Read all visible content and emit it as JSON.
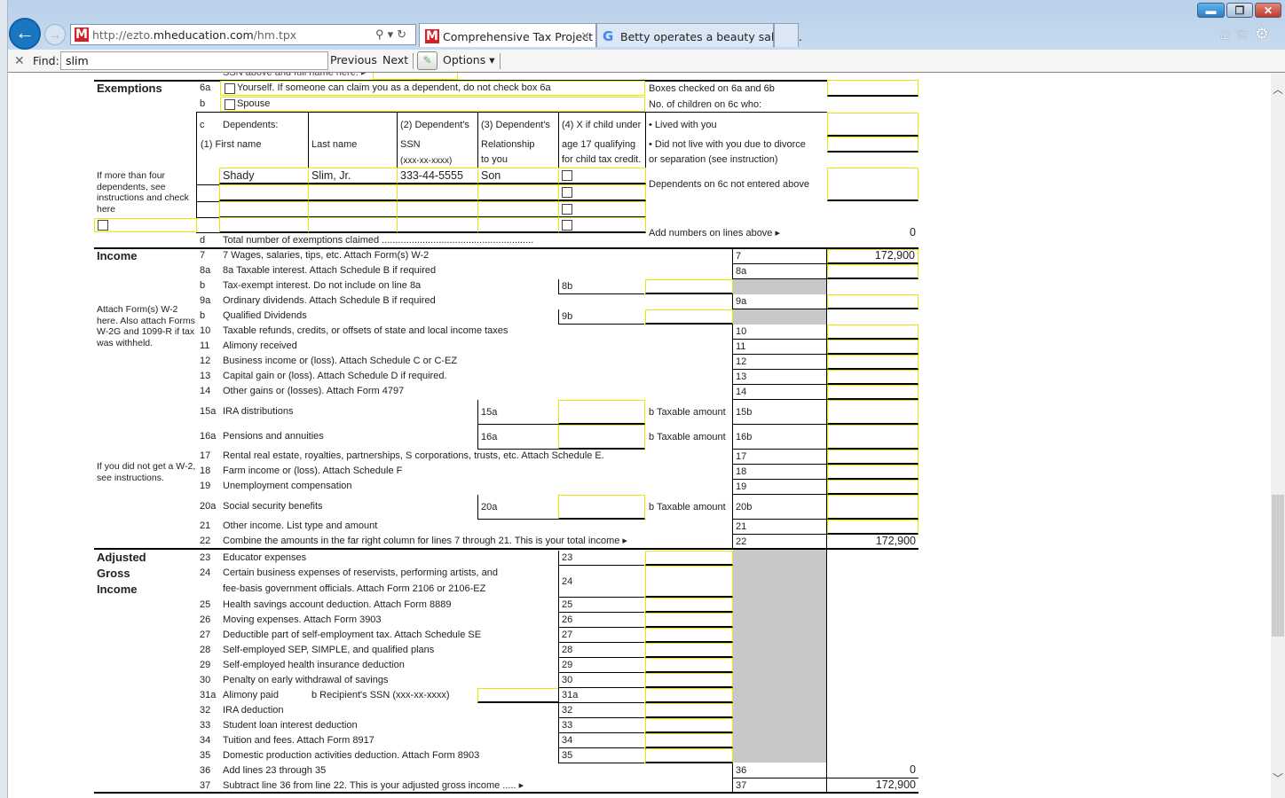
{
  "browser": {
    "url_prefix": "http://ezto.",
    "url_domain": "mheducation.com",
    "url_path": "/hm.tpx",
    "tabs": [
      {
        "label": "Comprehensive Tax Project",
        "icon": "mheducation-icon",
        "active": true
      },
      {
        "label": "Betty operates a beauty salon ...",
        "icon": "google-icon",
        "active": false
      }
    ],
    "find": {
      "label": "Find:",
      "value": "slim",
      "previous": "Previous",
      "next": "Next",
      "options": "Options"
    }
  },
  "form": {
    "top_cutoff": "SSN above and full name here. ▸",
    "exemptions": {
      "heading": "Exemptions",
      "line_6a": {
        "num": "6a",
        "label": "Yourself. If someone can claim you as a dependent, do not check box 6a",
        "checked": false
      },
      "line_6b": {
        "num": "b",
        "label": "Spouse",
        "checked": false
      },
      "dependents_header": {
        "c": "c",
        "dependents": "Dependents:",
        "first_name": "(1) First name",
        "last_name": "Last name",
        "ssn_1": "(2) Dependent's",
        "ssn_2": "SSN",
        "ssn_3": "(xxx-xx-xxxx)",
        "rel_1": "(3) Dependent's",
        "rel_2": "Relationship",
        "rel_3": "to you",
        "child_1": "(4) X if child under",
        "child_2": "age 17 qualifying",
        "child_3": "for child tax credit."
      },
      "dependents": [
        {
          "first": "Shady",
          "last": "Slim, Jr.",
          "ssn": "333-44-5555",
          "relationship": "Son",
          "child_credit": false
        },
        {
          "first": "",
          "last": "",
          "ssn": "",
          "relationship": "",
          "child_credit": false
        },
        {
          "first": "",
          "last": "",
          "ssn": "",
          "relationship": "",
          "child_credit": false
        },
        {
          "first": "",
          "last": "",
          "ssn": "",
          "relationship": "",
          "child_credit": false
        }
      ],
      "more_than_four": "If more than four dependents, see instructions and check here",
      "line_d": {
        "num": "d",
        "label": "Total number of exemptions claimed ........................................................"
      },
      "right": {
        "boxes_checked": "Boxes checked on 6a and 6b",
        "no_children": "No. of children on 6c who:",
        "lived_with": "• Lived with you",
        "did_not_live_1": "• Did not live with you due to divorce",
        "did_not_live_2": "or separation (see instruction)",
        "dependents_not_entered": "Dependents on 6c not entered above",
        "add_numbers": "Add numbers on lines above ▸",
        "total": "0"
      }
    },
    "income": {
      "heading": "Income",
      "attach_note": "Attach Form(s) W-2 here. Also attach Forms W-2G and 1099-R if tax was withheld.",
      "no_w2_note": "If you did not get a W-2, see instructions.",
      "taxable_amount": "b Taxable amount",
      "lines": [
        {
          "num": "7",
          "label": "7 Wages, salaries, tips, etc. Attach Form(s) W-2",
          "box": "7",
          "value": "172,900"
        },
        {
          "num": "8a",
          "label": "8a Taxable interest. Attach Schedule B if required",
          "box": "8a",
          "value": ""
        },
        {
          "num": "b",
          "label": "Tax-exempt interest. Do not include on line 8a",
          "box": "8b",
          "value": ""
        },
        {
          "num": "9a",
          "label": "Ordinary dividends. Attach Schedule B if required",
          "box": "9a",
          "value": ""
        },
        {
          "num": "b",
          "label": "Qualified Dividends",
          "box": "9b",
          "value": ""
        },
        {
          "num": "10",
          "label": "Taxable refunds, credits, or offsets of state and local income taxes",
          "box": "10",
          "value": ""
        },
        {
          "num": "11",
          "label": "Alimony received",
          "box": "11",
          "value": ""
        },
        {
          "num": "12",
          "label": "Business income or (loss). Attach Schedule C or C-EZ",
          "box": "12",
          "value": ""
        },
        {
          "num": "13",
          "label": "Capital gain or (loss). Attach Schedule D if required.",
          "box": "13",
          "value": ""
        },
        {
          "num": "14",
          "label": "Other gains or (losses). Attach Form 4797",
          "box": "14",
          "value": ""
        },
        {
          "num": "15a",
          "label": "IRA distributions",
          "box": "15a",
          "box_b": "15b",
          "value": ""
        },
        {
          "num": "16a",
          "label": "Pensions and annuities",
          "box": "16a",
          "box_b": "16b",
          "value": ""
        },
        {
          "num": "17",
          "label": "Rental real estate, royalties, partnerships, S corporations, trusts, etc. Attach Schedule E.",
          "box": "17",
          "value": ""
        },
        {
          "num": "18",
          "label": "Farm income or (loss). Attach Schedule F",
          "box": "18",
          "value": ""
        },
        {
          "num": "19",
          "label": "Unemployment compensation",
          "box": "19",
          "value": ""
        },
        {
          "num": "20a",
          "label": "Social security benefits",
          "box": "20a",
          "box_b": "20b",
          "value": ""
        },
        {
          "num": "21",
          "label": "Other income. List type and amount",
          "box": "21",
          "value": ""
        },
        {
          "num": "22",
          "label": "Combine the amounts in the far right column for lines 7 through 21. This is your total income ▸",
          "box": "22",
          "value": "172,900"
        }
      ]
    },
    "agi": {
      "heading_1": "Adjusted",
      "heading_2": "Gross",
      "heading_3": "Income",
      "lines": [
        {
          "num": "23",
          "label": "Educator expenses",
          "box": "23"
        },
        {
          "num": "24",
          "label": "Certain business expenses of reservists, performing artists, and",
          "label2": "fee-basis government officials. Attach Form 2106 or 2106-EZ",
          "box": "24"
        },
        {
          "num": "25",
          "label": "Health savings account deduction. Attach Form 8889",
          "box": "25"
        },
        {
          "num": "26",
          "label": "Moving expenses. Attach Form 3903",
          "box": "26"
        },
        {
          "num": "27",
          "label": "Deductible part of self-employment tax. Attach Schedule SE",
          "box": "27"
        },
        {
          "num": "28",
          "label": "Self-employed SEP, SIMPLE, and qualified plans",
          "box": "28"
        },
        {
          "num": "29",
          "label": "Self-employed health insurance deduction",
          "box": "29"
        },
        {
          "num": "30",
          "label": "Penalty on early withdrawal of savings",
          "box": "30"
        },
        {
          "num": "31a",
          "label": "Alimony paid",
          "label_b": "b Recipient's SSN (xxx-xx-xxxx)",
          "box": "31a"
        },
        {
          "num": "32",
          "label": "IRA deduction",
          "box": "32"
        },
        {
          "num": "33",
          "label": "Student loan interest deduction",
          "box": "33"
        },
        {
          "num": "34",
          "label": "Tuition and fees. Attach Form 8917",
          "box": "34"
        },
        {
          "num": "35",
          "label": "Domestic production activities deduction. Attach Form 8903",
          "box": "35"
        },
        {
          "num": "36",
          "label": "Add lines 23 through 35",
          "box": "36",
          "value": "0"
        },
        {
          "num": "37",
          "label": "Subtract line 36 from line 22. This is your adjusted gross income ..... ▸",
          "box": "37",
          "value": "172,900"
        }
      ]
    }
  }
}
